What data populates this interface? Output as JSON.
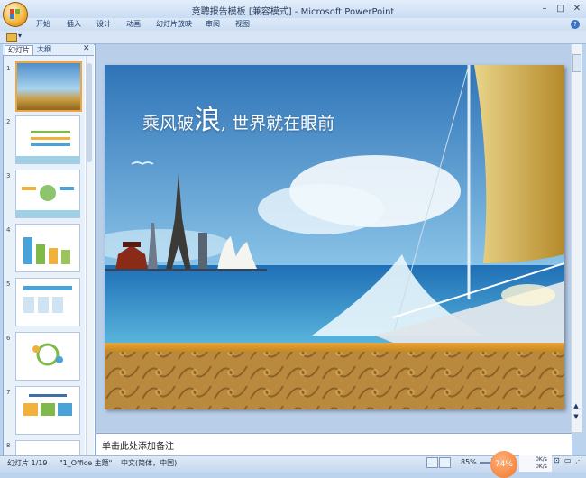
{
  "window": {
    "title": "竞聘报告模板 [兼容模式] - Microsoft PowerPoint",
    "min": "–",
    "max": "□",
    "close": "✕"
  },
  "ribbon": {
    "tabs": [
      "开始",
      "插入",
      "设计",
      "动画",
      "幻灯片放映",
      "审阅",
      "视图"
    ],
    "help": "?"
  },
  "qat": {
    "more": "▾"
  },
  "panel": {
    "tab_slides": "幻灯片",
    "tab_outline": "大纲",
    "close": "✕",
    "numbers": [
      "1",
      "2",
      "3",
      "4",
      "5",
      "6",
      "7",
      "8"
    ]
  },
  "slide": {
    "headline_a": "乘风破",
    "headline_big": "浪",
    "headline_b": ", 世界就在眼前"
  },
  "notes": {
    "placeholder": "单击此处添加备注"
  },
  "status": {
    "slide_info": "幻灯片 1/19",
    "theme": "\"1_Office 主题\"",
    "lang": "中文(简体，中国)",
    "zoom": "85%",
    "perf": "74%",
    "net_up": "0K/s",
    "net_down": "0K/s"
  },
  "colors": {
    "accent": "#f0a640",
    "ribbon": "#cddff4",
    "status": "#c5d8ef"
  }
}
